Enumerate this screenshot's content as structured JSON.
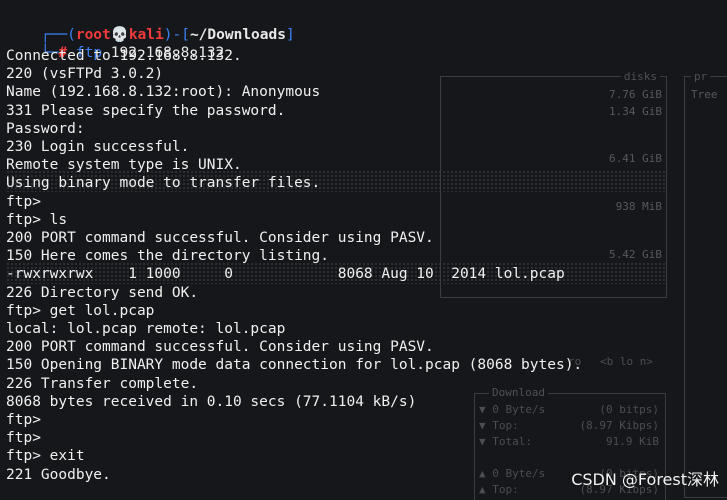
{
  "prompt": {
    "open_bracket": "┌──(",
    "user": "root",
    "skull": "💀",
    "host": "kali",
    "mid": ")-[",
    "path": "~/Downloads",
    "close": "]",
    "corner": "└─",
    "hash": "#",
    "command": "ftp",
    "arg": "192.168.8.132"
  },
  "session_lines": [
    "Connected to 192.168.8.132.",
    "220 (vsFTPd 3.0.2)",
    "Name (192.168.8.132:root): Anonymous",
    "331 Please specify the password.",
    "Password:",
    "230 Login successful.",
    "Remote system type is UNIX.",
    "Using binary mode to transfer files.",
    "ftp>",
    "ftp> ls",
    "200 PORT command successful. Consider using PASV.",
    "150 Here comes the directory listing.",
    "-rwxrwxrwx    1 1000     0            8068 Aug 10  2014 lol.pcap",
    "226 Directory send OK.",
    "ftp> get lol.pcap",
    "local: lol.pcap remote: lol.pcap",
    "200 PORT command successful. Consider using PASV.",
    "150 Opening BINARY mode data connection for lol.pcap (8068 bytes).",
    "226 Transfer complete.",
    "8068 bytes received in 0.10 secs (77.1104 kB/s)",
    "ftp>",
    "ftp>",
    "ftp> exit",
    "221 Goodbye."
  ],
  "background": {
    "disks_title": "disks",
    "disk_values": [
      "7.76 GiB",
      "1.34 GiB",
      "6.41 GiB",
      "938 MiB",
      "5.42 GiB"
    ],
    "proc_title": "pr",
    "tree_label": "Tree",
    "download_title": "Download",
    "download_rows": [
      {
        "label": "▼ 0 Byte/s",
        "value": "(0 bitps)"
      },
      {
        "label": "▼ Top:",
        "value": "(8.97 Kibps)"
      },
      {
        "label": "▼ Total:",
        "value": "91.9 KiB"
      },
      {
        "label": "▲ 0 Byte/s",
        "value": "(0 bitps)"
      },
      {
        "label": "▲ Top:",
        "value": "(8.97 Kibps)"
      }
    ],
    "nav_hint": "<b lo n>",
    "nav_hint_left": "ro"
  },
  "watermark": "CSDN @Forest深林"
}
